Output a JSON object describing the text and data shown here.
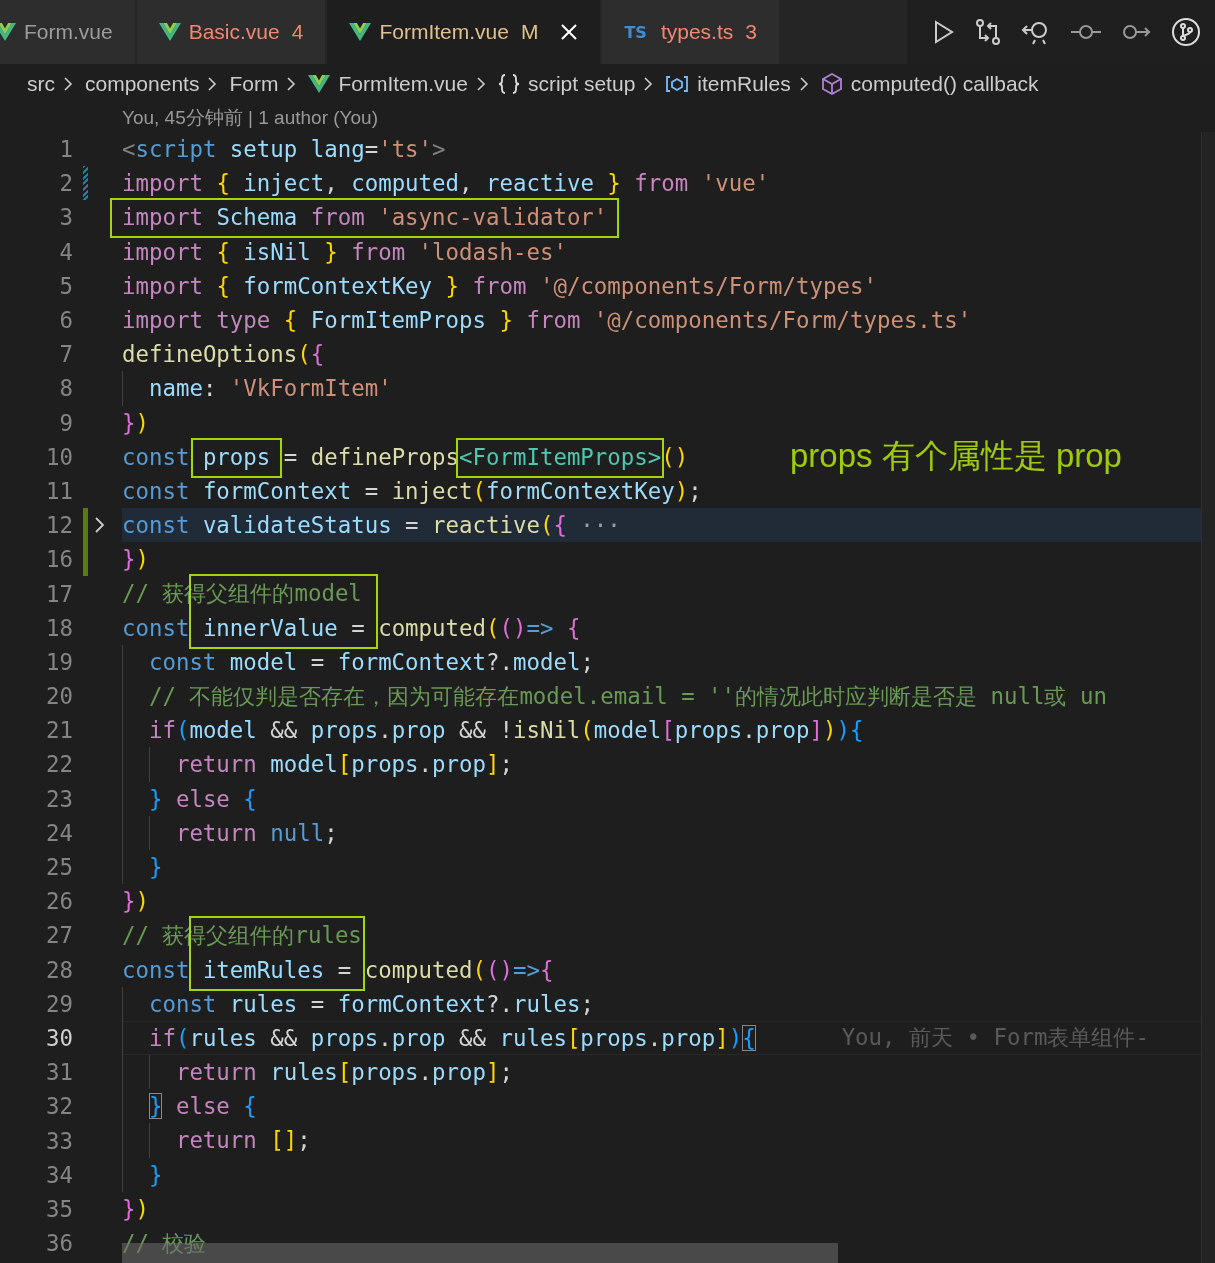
{
  "tabs": [
    {
      "label": "Form.vue",
      "kind": "normal",
      "selected": false
    },
    {
      "label": "Basic.vue",
      "kind": "error",
      "badge": "4",
      "selected": false
    },
    {
      "label": "FormItem.vue",
      "kind": "modified",
      "badge": "M",
      "selected": true
    },
    {
      "label": "types.ts",
      "icon_label": "TS",
      "kind": "error",
      "badge": "3",
      "selected": false
    }
  ],
  "breadcrumbs": [
    {
      "label": "src"
    },
    {
      "label": "components"
    },
    {
      "label": "Form"
    },
    {
      "label": "FormItem.vue",
      "kind": "vue"
    },
    {
      "label": "script setup",
      "kind": "braces"
    },
    {
      "label": "itemRules",
      "kind": "variable"
    },
    {
      "label": "computed() callback",
      "kind": "method"
    }
  ],
  "codelens": "You, 45分钟前 | 1 author (You)",
  "lines": [
    {
      "number": "1",
      "tokens": [
        {
          "text": "<",
          "kind": "tag"
        },
        {
          "text": "script ",
          "kind": "decl"
        },
        {
          "text": "setup lang",
          "kind": "var"
        },
        {
          "text": "=",
          "kind": "op"
        },
        {
          "text": "'ts'",
          "kind": "str"
        },
        {
          "text": ">",
          "kind": "tag"
        }
      ]
    },
    {
      "number": "2",
      "modified": true,
      "tokens": [
        {
          "text": "import ",
          "kind": "kw"
        },
        {
          "text": "{ ",
          "kind": "br1"
        },
        {
          "text": "inject",
          "kind": "var"
        },
        {
          "text": ", ",
          "kind": "op"
        },
        {
          "text": "computed",
          "kind": "var"
        },
        {
          "text": ", ",
          "kind": "op"
        },
        {
          "text": "reactive ",
          "kind": "var"
        },
        {
          "text": "} ",
          "kind": "br1"
        },
        {
          "text": "from ",
          "kind": "kw"
        },
        {
          "text": "'vue'",
          "kind": "str"
        }
      ]
    },
    {
      "number": "3",
      "tokens": [
        {
          "text": "import ",
          "kind": "kw",
          "frame": {
            "kind": "wide"
          }
        },
        {
          "text": "Schema ",
          "kind": "var"
        },
        {
          "text": "from ",
          "kind": "kw"
        },
        {
          "text": "'async-validator'",
          "kind": "str",
          "frame_end": true
        }
      ]
    },
    {
      "number": "4",
      "tokens": [
        {
          "text": "import ",
          "kind": "kw"
        },
        {
          "text": "{ ",
          "kind": "br1"
        },
        {
          "text": "isNil ",
          "kind": "var"
        },
        {
          "text": "} ",
          "kind": "br1"
        },
        {
          "text": "from ",
          "kind": "kw"
        },
        {
          "text": "'lodash-es'",
          "kind": "str"
        }
      ]
    },
    {
      "number": "5",
      "tokens": [
        {
          "text": "import ",
          "kind": "kw"
        },
        {
          "text": "{ ",
          "kind": "br1"
        },
        {
          "text": "formContextKey ",
          "kind": "var"
        },
        {
          "text": "} ",
          "kind": "br1"
        },
        {
          "text": "from ",
          "kind": "kw"
        },
        {
          "text": "'@/components/Form/types'",
          "kind": "str"
        }
      ]
    },
    {
      "number": "6",
      "tokens": [
        {
          "text": "import type ",
          "kind": "kw"
        },
        {
          "text": "{ ",
          "kind": "br1"
        },
        {
          "text": "FormItemProps ",
          "kind": "var"
        },
        {
          "text": "} ",
          "kind": "br1"
        },
        {
          "text": "from ",
          "kind": "kw"
        },
        {
          "text": "'@/components/Form/types.ts'",
          "kind": "str"
        }
      ]
    },
    {
      "number": "7",
      "tokens": [
        {
          "text": "defineOptions",
          "kind": "fn"
        },
        {
          "text": "(",
          "kind": "br1"
        },
        {
          "text": "{",
          "kind": "br2"
        }
      ]
    },
    {
      "number": "8",
      "tokens": [
        {
          "text": "  name",
          "kind": "var"
        },
        {
          "text": ": ",
          "kind": "op"
        },
        {
          "text": "'VkFormItem'",
          "kind": "str"
        }
      ]
    },
    {
      "number": "9",
      "tokens": [
        {
          "text": "}",
          "kind": "br2"
        },
        {
          "text": ")",
          "kind": "br1"
        }
      ]
    },
    {
      "number": "10",
      "note": "props 有个属性是 prop",
      "tokens": [
        {
          "text": "const ",
          "kind": "decl"
        },
        {
          "text": "props",
          "kind": "var",
          "frame": {
            "kind": "wide"
          },
          "frame_end": true
        },
        {
          "text": " = ",
          "kind": "op"
        },
        {
          "text": "defineProps",
          "kind": "fn"
        },
        {
          "text": "<FormItemProps>",
          "kind": "type",
          "frame": {
            "kind": "tight"
          },
          "frame_end": true
        },
        {
          "text": "()",
          "kind": "br1"
        }
      ]
    },
    {
      "number": "11",
      "tokens": [
        {
          "text": "const ",
          "kind": "decl"
        },
        {
          "text": "formContext",
          "kind": "var"
        },
        {
          "text": " = ",
          "kind": "op"
        },
        {
          "text": "inject",
          "kind": "fn"
        },
        {
          "text": "(",
          "kind": "br1"
        },
        {
          "text": "formContextKey",
          "kind": "var"
        },
        {
          "text": ")",
          "kind": "br1"
        },
        {
          "text": ";",
          "kind": "op"
        }
      ]
    },
    {
      "number": "12",
      "added": true,
      "folded": true,
      "highlighted": true,
      "tokens": [
        {
          "text": "const ",
          "kind": "decl"
        },
        {
          "text": "validateStatus",
          "kind": "var"
        },
        {
          "text": " = ",
          "kind": "op"
        },
        {
          "text": "reactive",
          "kind": "fn"
        },
        {
          "text": "(",
          "kind": "br1"
        },
        {
          "text": "{",
          "kind": "br2"
        },
        {
          "text": " ···",
          "kind": "fold"
        }
      ]
    },
    {
      "number": "16",
      "added": true,
      "tokens": [
        {
          "text": "}",
          "kind": "br2"
        },
        {
          "text": ")",
          "kind": "br1"
        }
      ]
    },
    {
      "number": "17",
      "tokens": [
        {
          "text": "// 获得父组件的model",
          "kind": "cmt"
        }
      ]
    },
    {
      "number": "18",
      "tokens": [
        {
          "text": "const",
          "kind": "decl"
        },
        {
          "text": " innerValue",
          "kind": "var",
          "frame": {
            "kind": "tall"
          }
        },
        {
          "text": " = ",
          "kind": "op",
          "frame_end": true
        },
        {
          "text": "computed",
          "kind": "fn"
        },
        {
          "text": "(",
          "kind": "br1"
        },
        {
          "text": "()",
          "kind": "br2"
        },
        {
          "text": "=> ",
          "kind": "decl"
        },
        {
          "text": "{",
          "kind": "br2"
        }
      ]
    },
    {
      "number": "19",
      "tokens": [
        {
          "text": "  const ",
          "kind": "decl"
        },
        {
          "text": "model",
          "kind": "var"
        },
        {
          "text": " = ",
          "kind": "op"
        },
        {
          "text": "formContext",
          "kind": "var"
        },
        {
          "text": "?.",
          "kind": "op"
        },
        {
          "text": "model",
          "kind": "var"
        },
        {
          "text": ";",
          "kind": "op"
        }
      ]
    },
    {
      "number": "20",
      "tokens": [
        {
          "text": "  // 不能仅判是否存在，因为可能存在model.email = ''的情况此时应判断是否是 null或 un",
          "kind": "cmt"
        }
      ]
    },
    {
      "number": "21",
      "tokens": [
        {
          "text": "  if",
          "kind": "kw"
        },
        {
          "text": "(",
          "kind": "br3"
        },
        {
          "text": "model",
          "kind": "var"
        },
        {
          "text": " && ",
          "kind": "op"
        },
        {
          "text": "props",
          "kind": "var"
        },
        {
          "text": ".",
          "kind": "op"
        },
        {
          "text": "prop",
          "kind": "var"
        },
        {
          "text": " && !",
          "kind": "op"
        },
        {
          "text": "isNil",
          "kind": "fn"
        },
        {
          "text": "(",
          "kind": "br1"
        },
        {
          "text": "model",
          "kind": "var"
        },
        {
          "text": "[",
          "kind": "br2"
        },
        {
          "text": "props",
          "kind": "var"
        },
        {
          "text": ".",
          "kind": "op"
        },
        {
          "text": "prop",
          "kind": "var"
        },
        {
          "text": "]",
          "kind": "br2"
        },
        {
          "text": ")",
          "kind": "br1"
        },
        {
          "text": "){",
          "kind": "br3"
        }
      ]
    },
    {
      "number": "22",
      "tokens": [
        {
          "text": "    return ",
          "kind": "kw"
        },
        {
          "text": "model",
          "kind": "var"
        },
        {
          "text": "[",
          "kind": "br1"
        },
        {
          "text": "props",
          "kind": "var"
        },
        {
          "text": ".",
          "kind": "op"
        },
        {
          "text": "prop",
          "kind": "var"
        },
        {
          "text": "]",
          "kind": "br1"
        },
        {
          "text": ";",
          "kind": "op"
        }
      ]
    },
    {
      "number": "23",
      "tokens": [
        {
          "text": "  } ",
          "kind": "br3"
        },
        {
          "text": "else ",
          "kind": "kw"
        },
        {
          "text": "{",
          "kind": "br3"
        }
      ]
    },
    {
      "number": "24",
      "tokens": [
        {
          "text": "    return ",
          "kind": "kw"
        },
        {
          "text": "null",
          "kind": "decl"
        },
        {
          "text": ";",
          "kind": "op"
        }
      ]
    },
    {
      "number": "25",
      "tokens": [
        {
          "text": "  }",
          "kind": "br3"
        }
      ]
    },
    {
      "number": "26",
      "tokens": [
        {
          "text": "}",
          "kind": "br2"
        },
        {
          "text": ")",
          "kind": "br1"
        }
      ]
    },
    {
      "number": "27",
      "tokens": [
        {
          "text": "// 获得父组件的rules",
          "kind": "cmt"
        }
      ]
    },
    {
      "number": "28",
      "tokens": [
        {
          "text": "const",
          "kind": "decl"
        },
        {
          "text": " itemRules",
          "kind": "var",
          "frame": {
            "kind": "tall"
          }
        },
        {
          "text": " = ",
          "kind": "op",
          "frame_end": true
        },
        {
          "text": "computed",
          "kind": "fn"
        },
        {
          "text": "(",
          "kind": "br1"
        },
        {
          "text": "()",
          "kind": "br2"
        },
        {
          "text": "=>",
          "kind": "decl"
        },
        {
          "text": "{",
          "kind": "br2"
        }
      ]
    },
    {
      "number": "29",
      "tokens": [
        {
          "text": "  const ",
          "kind": "decl"
        },
        {
          "text": "rules",
          "kind": "var"
        },
        {
          "text": " = ",
          "kind": "op"
        },
        {
          "text": "formContext",
          "kind": "var"
        },
        {
          "text": "?.",
          "kind": "op"
        },
        {
          "text": "rules",
          "kind": "var"
        },
        {
          "text": ";",
          "kind": "op"
        }
      ]
    },
    {
      "number": "30",
      "current": true,
      "blame": "You, 前天 • Form表单组件-",
      "tokens": [
        {
          "text": "  if",
          "kind": "kw"
        },
        {
          "text": "(",
          "kind": "br3"
        },
        {
          "text": "rules",
          "kind": "var"
        },
        {
          "text": " && ",
          "kind": "op"
        },
        {
          "text": "props",
          "kind": "var"
        },
        {
          "text": ".",
          "kind": "op"
        },
        {
          "text": "prop",
          "kind": "var"
        },
        {
          "text": " && ",
          "kind": "op"
        },
        {
          "text": "rules",
          "kind": "var"
        },
        {
          "text": "[",
          "kind": "br1"
        },
        {
          "text": "props",
          "kind": "var"
        },
        {
          "text": ".",
          "kind": "op"
        },
        {
          "text": "prop",
          "kind": "var"
        },
        {
          "text": "]",
          "kind": "br1"
        },
        {
          "text": ")",
          "kind": "br3"
        },
        {
          "text": "{",
          "kind": "br3",
          "match": true
        }
      ]
    },
    {
      "number": "31",
      "tokens": [
        {
          "text": "    return ",
          "kind": "kw"
        },
        {
          "text": "rules",
          "kind": "var"
        },
        {
          "text": "[",
          "kind": "br1"
        },
        {
          "text": "props",
          "kind": "var"
        },
        {
          "text": ".",
          "kind": "op"
        },
        {
          "text": "prop",
          "kind": "var"
        },
        {
          "text": "]",
          "kind": "br1"
        },
        {
          "text": ";",
          "kind": "op"
        }
      ]
    },
    {
      "number": "32",
      "tokens": [
        {
          "text": "  }",
          "kind": "br3",
          "match": true
        },
        {
          "text": " else ",
          "kind": "kw"
        },
        {
          "text": "{",
          "kind": "br3"
        }
      ]
    },
    {
      "number": "33",
      "tokens": [
        {
          "text": "    return ",
          "kind": "kw"
        },
        {
          "text": "[]",
          "kind": "br1"
        },
        {
          "text": ";",
          "kind": "op"
        }
      ]
    },
    {
      "number": "34",
      "tokens": [
        {
          "text": "  }",
          "kind": "br3"
        }
      ]
    },
    {
      "number": "35",
      "tokens": [
        {
          "text": "}",
          "kind": "br2"
        },
        {
          "text": ")",
          "kind": "br1"
        }
      ]
    },
    {
      "number": "36",
      "tokens": [
        {
          "text": "// 校验",
          "kind": "cmt"
        }
      ]
    }
  ]
}
